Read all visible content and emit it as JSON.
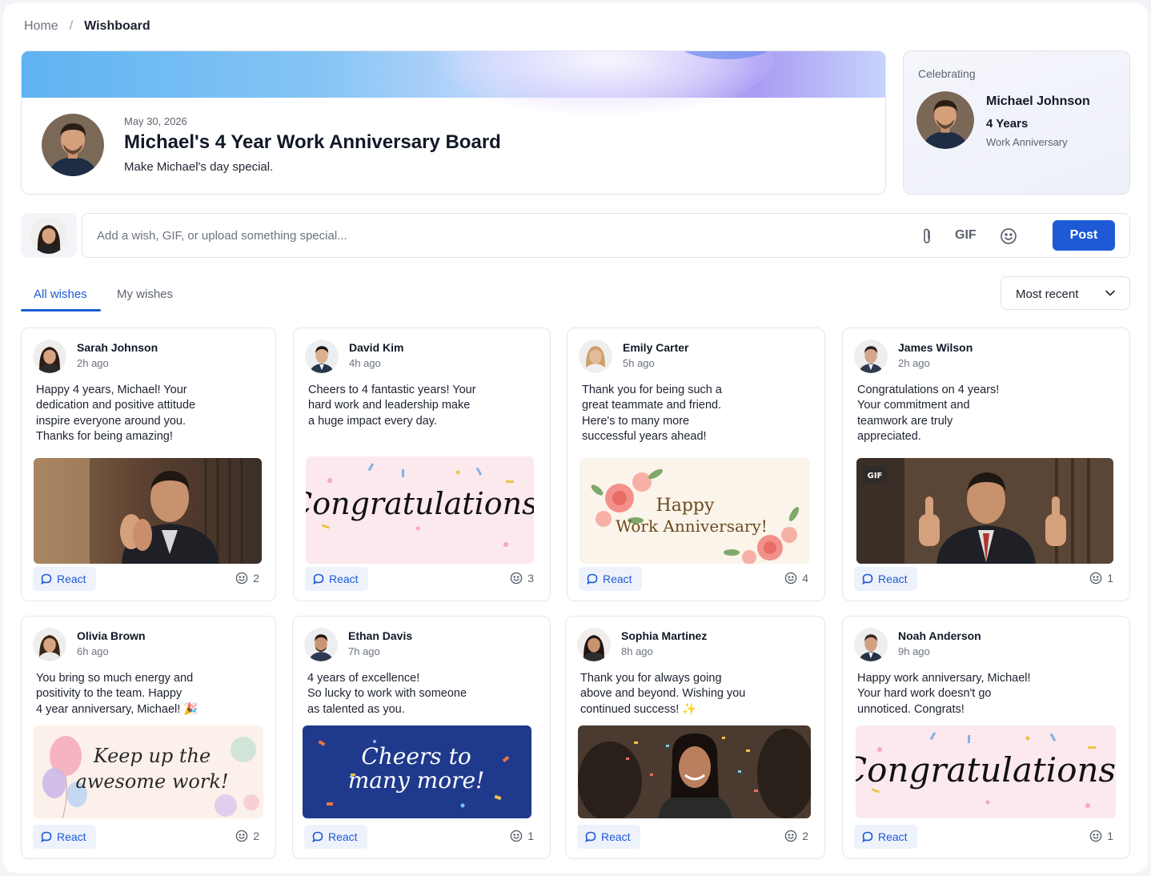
{
  "breadcrumb": {
    "home": "Home",
    "separator": "/",
    "current": "Wishboard"
  },
  "hero": {
    "date": "May 30, 2026",
    "title": "Michael's 4 Year Work Anniversary Board",
    "subtitle": "Make Michael's day special."
  },
  "celebrating": {
    "label": "Celebrating",
    "name": "Michael Johnson",
    "years": "4 Years",
    "type": "Work Anniversary"
  },
  "composer": {
    "placeholder": "Add a wish, GIF, or upload something special...",
    "gif_label": "GIF",
    "post_label": "Post"
  },
  "tabs": [
    {
      "label": "All wishes",
      "active": true
    },
    {
      "label": "My wishes",
      "active": false
    }
  ],
  "sort": {
    "selected": "Most recent"
  },
  "colors": {
    "accent": "#1e5ad6",
    "react_bg": "#eef2fb"
  },
  "react_label": "React",
  "wishes": [
    {
      "name": "Sarah Johnson",
      "time": "2h ago",
      "message": "Happy 4 years, Michael! Your\ndedication and positive attitude\ninspire everyone around you.\nThanks for being amazing!",
      "media": "clapping-photo",
      "reactions": "2"
    },
    {
      "name": "David Kim",
      "time": "4h ago",
      "message": "Cheers to 4 fantastic years! Your\nhard work and leadership make\na huge impact every day.",
      "media": "congratulations-card",
      "media_text": "Congratulations!",
      "reactions": "3"
    },
    {
      "name": "Emily Carter",
      "time": "5h ago",
      "message": "Thank you for being such a\ngreat teammate and friend.\nHere's to many more\nsuccessful years ahead!",
      "media": "floral-card",
      "media_text_1": "Happy",
      "media_text_2": "Work Anniversary!",
      "reactions": "4"
    },
    {
      "name": "James Wilson",
      "time": "2h ago",
      "message": "Congratulations on 4 years!\nYour commitment and\nteamwork are truly\nappreciated.",
      "media": "thumbs-up-gif",
      "media_badge": "GIF",
      "reactions": "1"
    },
    {
      "name": "Olivia Brown",
      "time": "6h ago",
      "message": "You bring so much energy and\npositivity to the team. Happy\n4 year anniversary, Michael! 🎉",
      "media": "balloon-card",
      "media_text_1": "Keep up the",
      "media_text_2": "awesome work!",
      "reactions": "2"
    },
    {
      "name": "Ethan Davis",
      "time": "7h ago",
      "message": "4 years of excellence!\nSo lucky to work with someone\nas talented as you.",
      "media": "cheers-card",
      "media_text_1": "Cheers to",
      "media_text_2": "many more!",
      "reactions": "1"
    },
    {
      "name": "Sophia Martinez",
      "time": "8h ago",
      "message": "Thank you for always going\nabove and beyond. Wishing you\ncontinued success! ✨",
      "media": "celebration-photo",
      "reactions": "2"
    },
    {
      "name": "Noah Anderson",
      "time": "9h ago",
      "message": "Happy work anniversary, Michael!\nYour hard work doesn't go\nunnoticed. Congrats!",
      "media": "congratulations-card",
      "media_text": "Congratulations!",
      "reactions": "1"
    }
  ]
}
